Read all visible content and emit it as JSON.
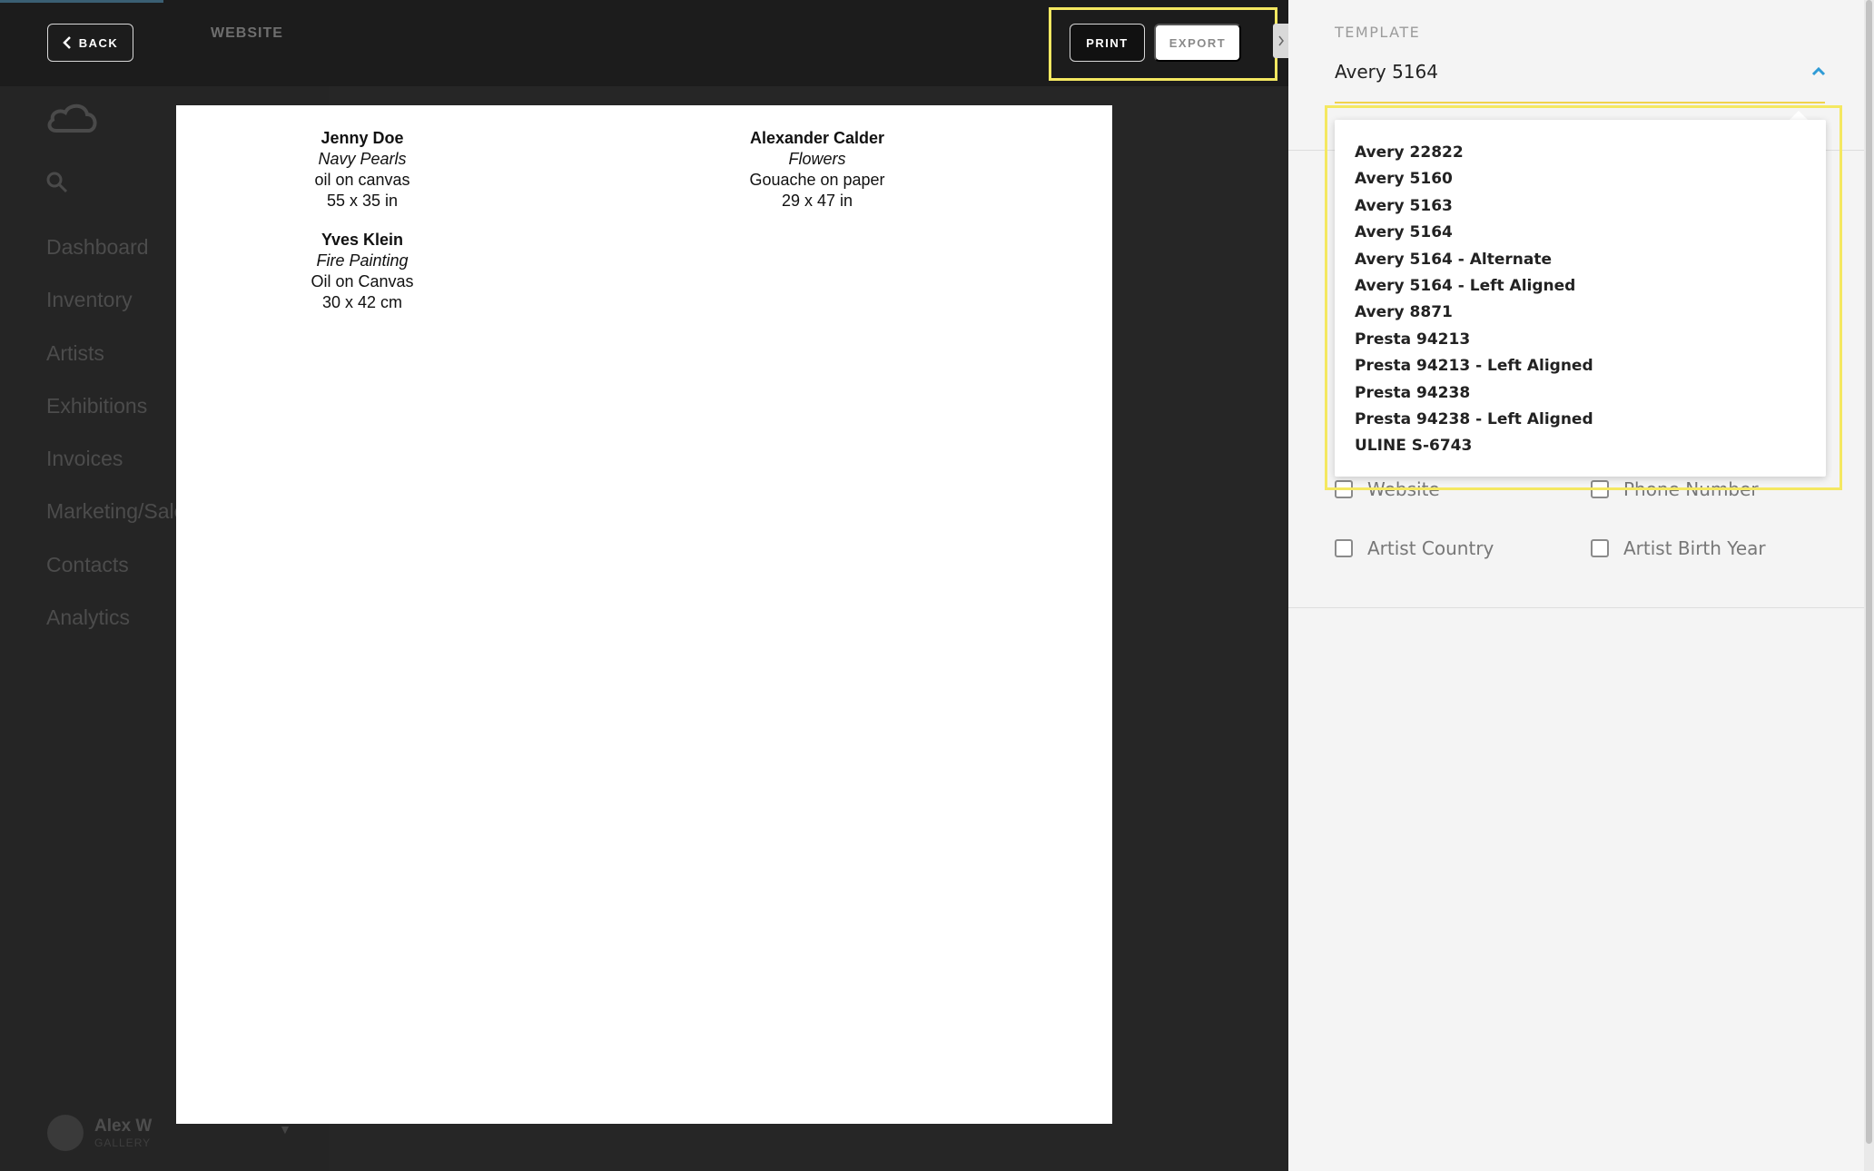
{
  "header": {
    "back_label": "BACK",
    "bg_tab_label": "WEBSITE",
    "print_label": "PRINT",
    "export_label": "EXPORT"
  },
  "sidebar": {
    "items": [
      "Dashboard",
      "Inventory",
      "Artists",
      "Exhibitions",
      "Invoices",
      "Marketing/Sales",
      "Contacts",
      "Analytics"
    ],
    "user": {
      "name": "Alex W",
      "role": "GALLERY"
    }
  },
  "labels": [
    {
      "artist": "Jenny Doe",
      "title": "Navy Pearls",
      "medium": "oil on canvas",
      "size": "55 x 35 in"
    },
    {
      "artist": "Alexander Calder",
      "title": "Flowers",
      "medium": "Gouache on paper",
      "size": "29 x 47 in"
    },
    {
      "artist": "Yves Klein",
      "title": "Fire Painting",
      "medium": "Oil on Canvas",
      "size": "30 x 42 cm"
    }
  ],
  "panel": {
    "template_label": "TEMPLATE",
    "template_value": "Avery 5164",
    "options": [
      "Website",
      "Phone Number",
      "Artist Country",
      "Artist Birth Year"
    ]
  },
  "dropdown": {
    "items": [
      "Avery 22822",
      "Avery 5160",
      "Avery 5163",
      "Avery 5164",
      "Avery 5164 - Alternate",
      "Avery 5164 - Left Aligned",
      "Avery 8871",
      "Presta 94213",
      "Presta 94213 - Left Aligned",
      "Presta 94238",
      "Presta 94238 - Left Aligned",
      "ULINE S-6743"
    ]
  },
  "colors": {
    "highlight": "#f4e861",
    "accent": "#2f9bd6",
    "panel_bg": "#f4f4f4",
    "app_bg": "#262626"
  }
}
